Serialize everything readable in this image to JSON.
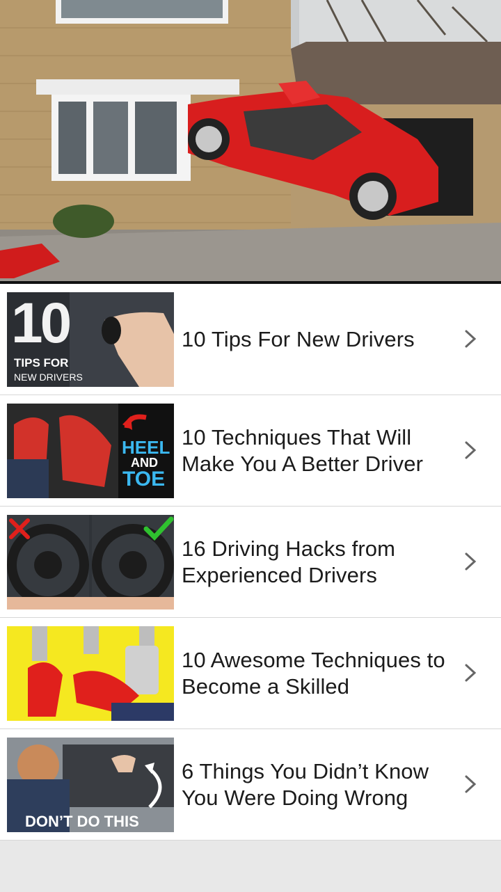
{
  "hero": {
    "image_icon": "crashed-red-car-into-house-photo"
  },
  "articles": [
    {
      "title": "10 Tips For New Drivers",
      "thumb_big": "10",
      "thumb_line1": "TIPS FOR",
      "thumb_line2": "NEW DRIVERS",
      "chevron_icon": "chevron-right-icon"
    },
    {
      "title": "10 Techniques That Will Make You A Better Driver",
      "thumb_line1": "HEEL",
      "thumb_line2": "AND",
      "thumb_line3": "TOE",
      "chevron_icon": "chevron-right-icon"
    },
    {
      "title": "16 Driving Hacks from Experienced Drivers",
      "chevron_icon": "chevron-right-icon"
    },
    {
      "title": "10 Awesome Techniques to Become a Skilled",
      "chevron_icon": "chevron-right-icon"
    },
    {
      "title": "6 Things You Didn’t Know You Were Doing Wrong",
      "thumb_caption": "DON’T DO THIS",
      "chevron_icon": "chevron-right-icon"
    }
  ],
  "colors": {
    "background": "#e8e8e8",
    "item_bg": "#ffffff",
    "divider": "#d6d6d6",
    "title_text": "#1b1b1b",
    "chevron": "#666666",
    "accent_red": "#e0201c"
  }
}
